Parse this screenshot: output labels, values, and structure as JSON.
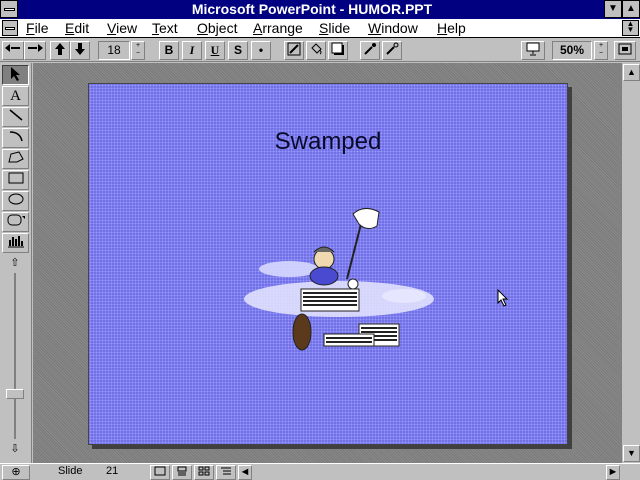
{
  "window": {
    "title": "Microsoft PowerPoint - HUMOR.PPT",
    "minimize_glyph": "▼",
    "maximize_glyph": "▲"
  },
  "menu": [
    "File",
    "Edit",
    "View",
    "Text",
    "Object",
    "Arrange",
    "Slide",
    "Window",
    "Help"
  ],
  "toolbar": {
    "font_size": "18",
    "bold": "B",
    "italic": "I",
    "underline": "U",
    "shadow": "S",
    "bullet": "•",
    "zoom": "50%"
  },
  "palette": {
    "text_tool": "A"
  },
  "slide": {
    "title": "Swamped",
    "background_color": "#6a6ae0"
  },
  "statusbar": {
    "slide_label": "Slide",
    "slide_number": "21"
  },
  "icons": {
    "cursor": "arrow-pointer-icon"
  }
}
